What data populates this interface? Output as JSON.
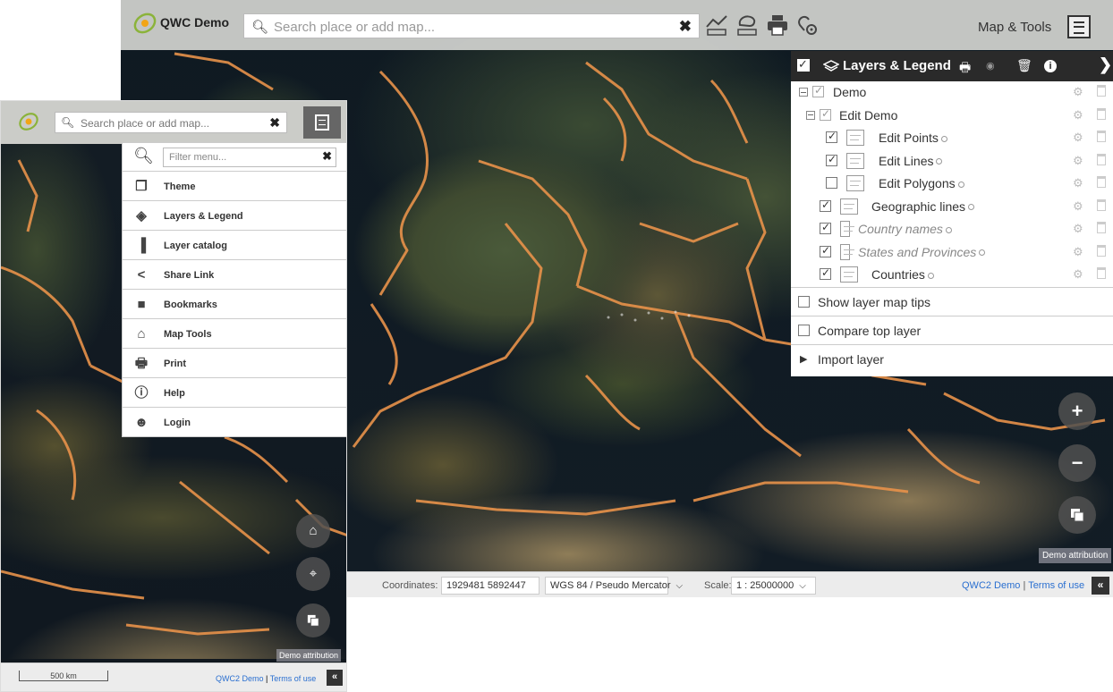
{
  "desktop": {
    "app_name": "QWC Demo",
    "search_placeholder": "Search place or add map...",
    "clear_symbol": "✖",
    "maptools_label": "Map & Tools",
    "layers_panel": {
      "title": "Layers & Legend",
      "layers": [
        {
          "label": "Demo",
          "checked": true,
          "group": true,
          "depth": 0
        },
        {
          "label": "Edit Demo",
          "checked": true,
          "group": true,
          "depth": 1
        },
        {
          "label": "Edit Points",
          "checked": true,
          "depth": 2
        },
        {
          "label": "Edit Lines",
          "checked": true,
          "depth": 2
        },
        {
          "label": "Edit Polygons",
          "checked": false,
          "depth": 2
        },
        {
          "label": "Geographic lines",
          "checked": true,
          "depth": 1
        },
        {
          "label": "Country names",
          "checked": true,
          "depth": 1,
          "dimmed": true
        },
        {
          "label": "States and Provinces",
          "checked": true,
          "depth": 1,
          "dimmed": true
        },
        {
          "label": "Countries",
          "checked": true,
          "depth": 1
        }
      ],
      "options": {
        "show_map_tips": "Show layer map tips",
        "compare_top": "Compare top layer",
        "import_layer": "Import layer"
      }
    },
    "zoom_in": "+",
    "zoom_out": "−",
    "attribution": "Demo attribution",
    "bottom": {
      "coordinates_label": "Coordinates:",
      "coordinates_value": "1929481 5892447",
      "crs_value": "WGS 84 / Pseudo Mercator",
      "scale_label": "Scale:",
      "scale_value": "1 : 25000000",
      "link_demo": "QWC2 Demo",
      "separator": "|",
      "link_terms": "Terms of use",
      "toggle": "«"
    }
  },
  "mobile": {
    "search_placeholder": "Search place or add map...",
    "clear_symbol": "✖",
    "filter_placeholder": "Filter menu...",
    "menu_items": [
      {
        "label": "Theme",
        "icon": "theme-icon"
      },
      {
        "label": "Layers & Legend",
        "icon": "layers-icon"
      },
      {
        "label": "Layer catalog",
        "icon": "catalog-icon"
      },
      {
        "label": "Share Link",
        "icon": "share-icon"
      },
      {
        "label": "Bookmarks",
        "icon": "bookmark-icon"
      },
      {
        "label": "Map Tools",
        "icon": "maptools-icon"
      },
      {
        "label": "Print",
        "icon": "print-icon"
      },
      {
        "label": "Help",
        "icon": "help-icon"
      },
      {
        "label": "Login",
        "icon": "login-icon"
      }
    ],
    "attribution": "Demo attribution",
    "scale_text": "500 km",
    "link_demo": "QWC2 Demo",
    "separator": "|",
    "link_terms": "Terms of use",
    "toggle": "«"
  },
  "colors": {
    "border_orange": "#e8924a",
    "topbar_bg": "#d2d4d0",
    "panel_header": "#2a2a2a",
    "link_blue": "#2a6fd0"
  }
}
